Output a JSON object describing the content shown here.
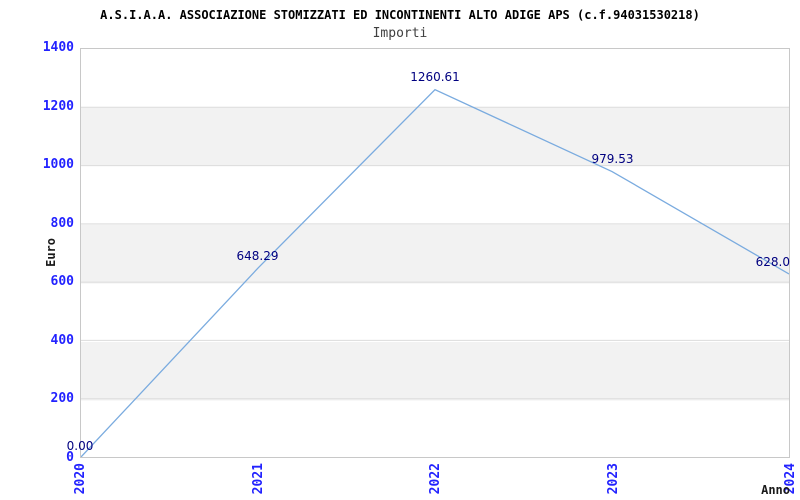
{
  "chart_data": {
    "type": "line",
    "title": "A.S.I.A.A. ASSOCIAZIONE STOMIZZATI ED INCONTINENTI ALTO ADIGE APS (c.f.94031530218)",
    "subtitle": "Importi",
    "xlabel": "Anno",
    "ylabel": "Euro",
    "x": [
      2020,
      2021,
      2022,
      2023,
      2024
    ],
    "values": [
      0.0,
      648.29,
      1260.61,
      979.53,
      628.0
    ],
    "point_labels": [
      "0.00",
      "648.29",
      "1260.61",
      "979.53",
      "628.0"
    ],
    "xticks": [
      "2020",
      "2021",
      "2022",
      "2023",
      "2024"
    ],
    "yticks": [
      0,
      200,
      400,
      600,
      800,
      1000,
      1200,
      1400
    ],
    "ylim": [
      0,
      1400
    ],
    "grid": "horizontal",
    "background_bands": "alternating",
    "legend": "none",
    "colors": {
      "line": "#7aabdf",
      "tick_text": "#2222ff",
      "point_label_text": "#000080",
      "band": "#f2f2f2",
      "grid_line": "#dcdcdc",
      "plot_border": "#c8c8c8",
      "title_text": "#000000",
      "axis_label_text": "#1a1a1a"
    }
  }
}
